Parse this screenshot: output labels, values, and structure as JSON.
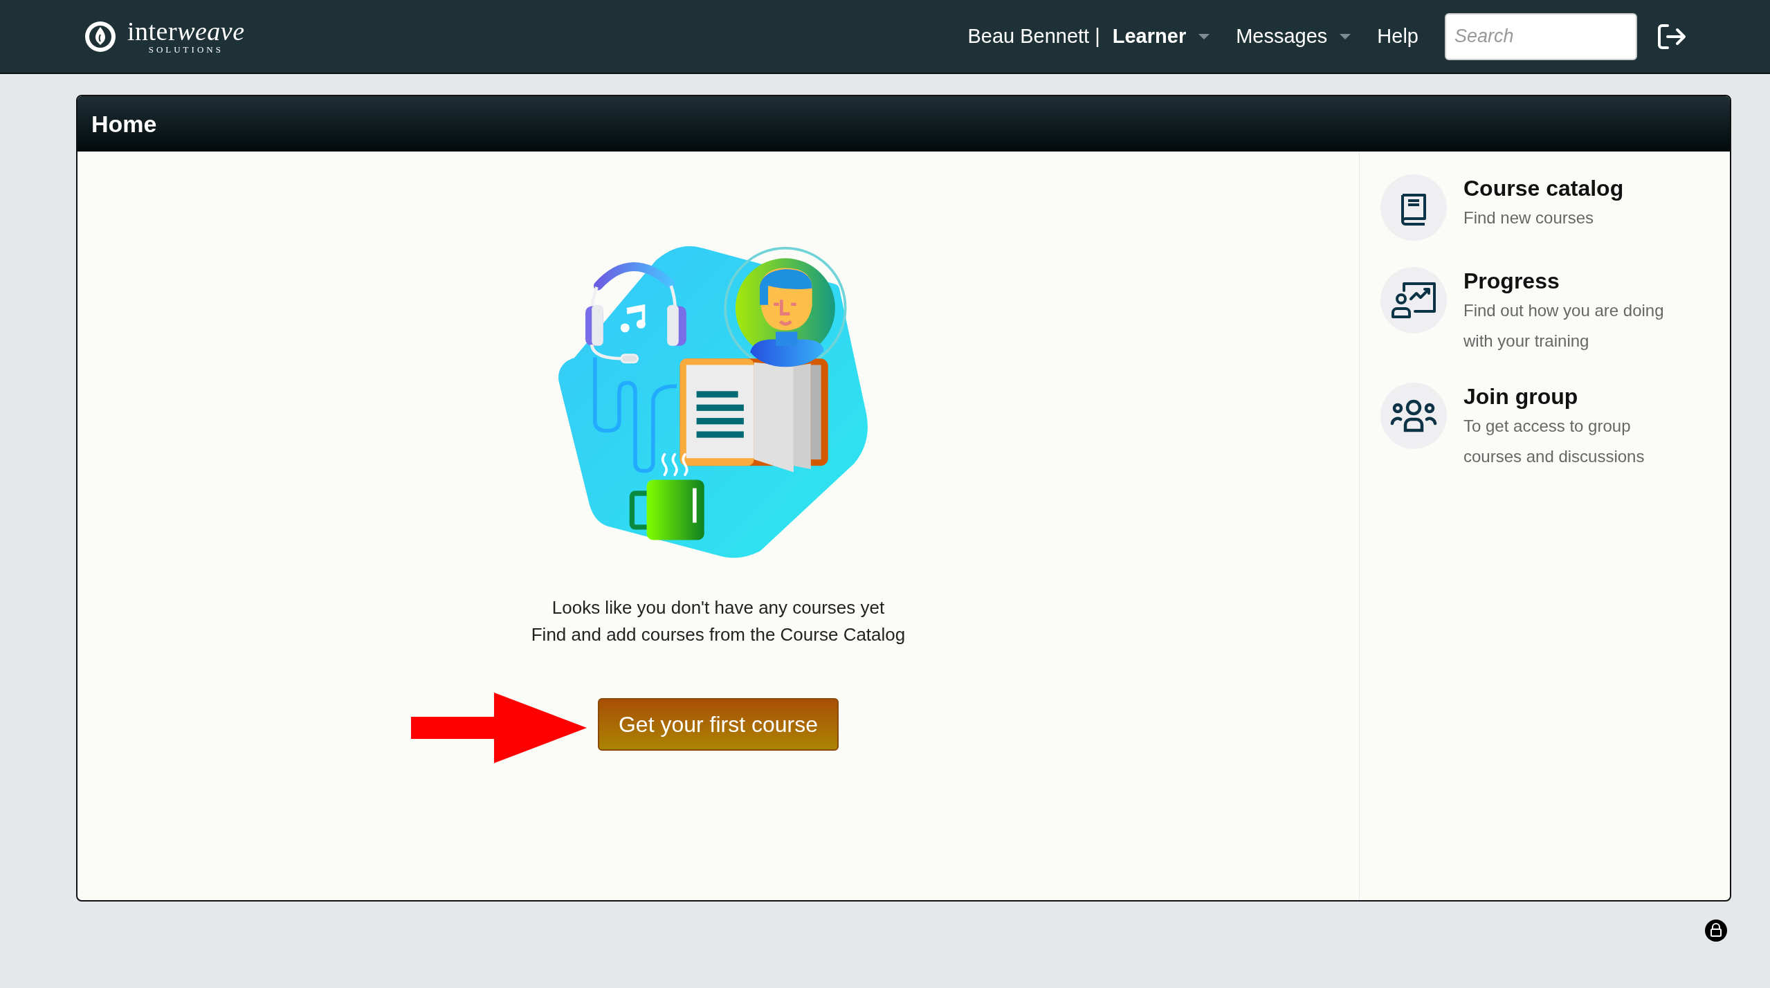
{
  "header": {
    "logo": {
      "name": [
        {
          "kind": "plain",
          "text": "inter"
        },
        {
          "kind": "emphasis",
          "text": "weave"
        }
      ],
      "tagline": "SOLUTIONS"
    },
    "nav": [
      {
        "kind": "dropdown",
        "label": "Beau Bennett | **Learner**"
      },
      {
        "kind": "dropdown",
        "label": "Messages"
      },
      {
        "kind": "link",
        "label": "Help"
      }
    ],
    "search": {
      "placeholder": "Search"
    }
  },
  "panel": {
    "title": "Home",
    "empty_state": {
      "lines": [
        "Looks like you don't have any courses yet",
        "Find and add courses from the Course Catalog"
      ],
      "button": "Get your first course"
    },
    "shortcuts": [
      {
        "kind": "book",
        "title": "Course catalog",
        "description": "Find new courses"
      },
      {
        "kind": "progress",
        "title": "Progress",
        "description": "Find out how you are doing with your training"
      },
      {
        "kind": "group",
        "title": "Join group",
        "description": "To get access to group courses and discussions"
      }
    ]
  }
}
